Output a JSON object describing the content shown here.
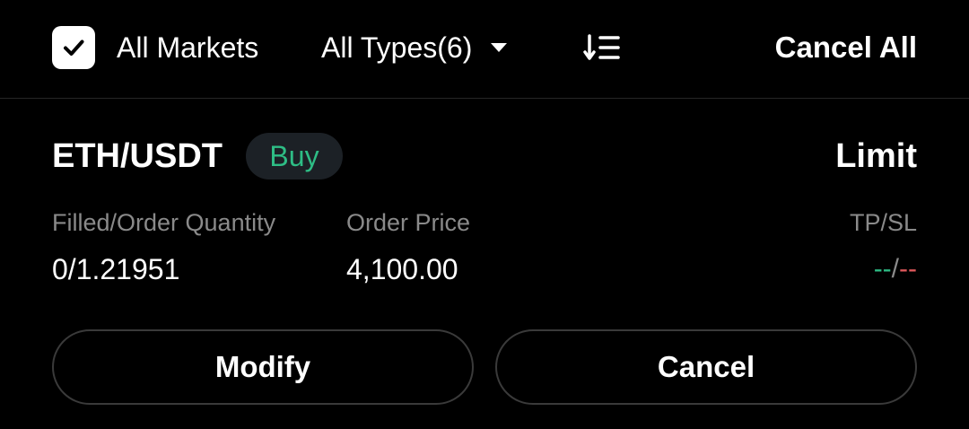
{
  "filters": {
    "all_markets_checked": true,
    "all_markets_label": "All Markets",
    "types_label": "All Types(6)",
    "sort_icon": "sort-icon",
    "cancel_all_label": "Cancel All"
  },
  "order": {
    "pair": "ETH/USDT",
    "side": "Buy",
    "type": "Limit",
    "fields": {
      "quantity_label": "Filled/Order Quantity",
      "quantity_value": "0/1.21951",
      "price_label": "Order Price",
      "price_value": "4,100.00",
      "tpsl_label": "TP/SL",
      "tp_value": "--",
      "tpsl_separator": "/",
      "sl_value": "--"
    },
    "actions": {
      "modify_label": "Modify",
      "cancel_label": "Cancel"
    }
  },
  "colors": {
    "background": "#000000",
    "buy": "#2ebd85",
    "sell": "#e0585b",
    "muted": "#8a8a8a",
    "border": "#3a3a3a"
  }
}
